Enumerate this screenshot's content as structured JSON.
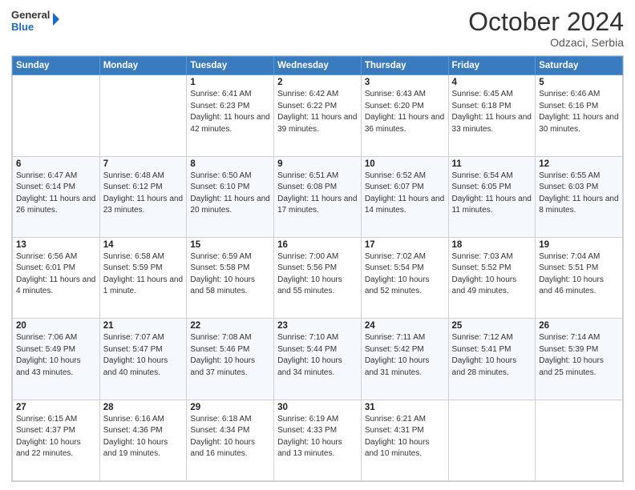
{
  "header": {
    "logo_general": "General",
    "logo_blue": "Blue",
    "month_title": "October 2024",
    "subtitle": "Odzaci, Serbia"
  },
  "weekdays": [
    "Sunday",
    "Monday",
    "Tuesday",
    "Wednesday",
    "Thursday",
    "Friday",
    "Saturday"
  ],
  "weeks": [
    [
      {
        "day": "",
        "info": ""
      },
      {
        "day": "",
        "info": ""
      },
      {
        "day": "1",
        "info": "Sunrise: 6:41 AM\nSunset: 6:23 PM\nDaylight: 11 hours and 42 minutes."
      },
      {
        "day": "2",
        "info": "Sunrise: 6:42 AM\nSunset: 6:22 PM\nDaylight: 11 hours and 39 minutes."
      },
      {
        "day": "3",
        "info": "Sunrise: 6:43 AM\nSunset: 6:20 PM\nDaylight: 11 hours and 36 minutes."
      },
      {
        "day": "4",
        "info": "Sunrise: 6:45 AM\nSunset: 6:18 PM\nDaylight: 11 hours and 33 minutes."
      },
      {
        "day": "5",
        "info": "Sunrise: 6:46 AM\nSunset: 6:16 PM\nDaylight: 11 hours and 30 minutes."
      }
    ],
    [
      {
        "day": "6",
        "info": "Sunrise: 6:47 AM\nSunset: 6:14 PM\nDaylight: 11 hours and 26 minutes."
      },
      {
        "day": "7",
        "info": "Sunrise: 6:48 AM\nSunset: 6:12 PM\nDaylight: 11 hours and 23 minutes."
      },
      {
        "day": "8",
        "info": "Sunrise: 6:50 AM\nSunset: 6:10 PM\nDaylight: 11 hours and 20 minutes."
      },
      {
        "day": "9",
        "info": "Sunrise: 6:51 AM\nSunset: 6:08 PM\nDaylight: 11 hours and 17 minutes."
      },
      {
        "day": "10",
        "info": "Sunrise: 6:52 AM\nSunset: 6:07 PM\nDaylight: 11 hours and 14 minutes."
      },
      {
        "day": "11",
        "info": "Sunrise: 6:54 AM\nSunset: 6:05 PM\nDaylight: 11 hours and 11 minutes."
      },
      {
        "day": "12",
        "info": "Sunrise: 6:55 AM\nSunset: 6:03 PM\nDaylight: 11 hours and 8 minutes."
      }
    ],
    [
      {
        "day": "13",
        "info": "Sunrise: 6:56 AM\nSunset: 6:01 PM\nDaylight: 11 hours and 4 minutes."
      },
      {
        "day": "14",
        "info": "Sunrise: 6:58 AM\nSunset: 5:59 PM\nDaylight: 11 hours and 1 minute."
      },
      {
        "day": "15",
        "info": "Sunrise: 6:59 AM\nSunset: 5:58 PM\nDaylight: 10 hours and 58 minutes."
      },
      {
        "day": "16",
        "info": "Sunrise: 7:00 AM\nSunset: 5:56 PM\nDaylight: 10 hours and 55 minutes."
      },
      {
        "day": "17",
        "info": "Sunrise: 7:02 AM\nSunset: 5:54 PM\nDaylight: 10 hours and 52 minutes."
      },
      {
        "day": "18",
        "info": "Sunrise: 7:03 AM\nSunset: 5:52 PM\nDaylight: 10 hours and 49 minutes."
      },
      {
        "day": "19",
        "info": "Sunrise: 7:04 AM\nSunset: 5:51 PM\nDaylight: 10 hours and 46 minutes."
      }
    ],
    [
      {
        "day": "20",
        "info": "Sunrise: 7:06 AM\nSunset: 5:49 PM\nDaylight: 10 hours and 43 minutes."
      },
      {
        "day": "21",
        "info": "Sunrise: 7:07 AM\nSunset: 5:47 PM\nDaylight: 10 hours and 40 minutes."
      },
      {
        "day": "22",
        "info": "Sunrise: 7:08 AM\nSunset: 5:46 PM\nDaylight: 10 hours and 37 minutes."
      },
      {
        "day": "23",
        "info": "Sunrise: 7:10 AM\nSunset: 5:44 PM\nDaylight: 10 hours and 34 minutes."
      },
      {
        "day": "24",
        "info": "Sunrise: 7:11 AM\nSunset: 5:42 PM\nDaylight: 10 hours and 31 minutes."
      },
      {
        "day": "25",
        "info": "Sunrise: 7:12 AM\nSunset: 5:41 PM\nDaylight: 10 hours and 28 minutes."
      },
      {
        "day": "26",
        "info": "Sunrise: 7:14 AM\nSunset: 5:39 PM\nDaylight: 10 hours and 25 minutes."
      }
    ],
    [
      {
        "day": "27",
        "info": "Sunrise: 6:15 AM\nSunset: 4:37 PM\nDaylight: 10 hours and 22 minutes."
      },
      {
        "day": "28",
        "info": "Sunrise: 6:16 AM\nSunset: 4:36 PM\nDaylight: 10 hours and 19 minutes."
      },
      {
        "day": "29",
        "info": "Sunrise: 6:18 AM\nSunset: 4:34 PM\nDaylight: 10 hours and 16 minutes."
      },
      {
        "day": "30",
        "info": "Sunrise: 6:19 AM\nSunset: 4:33 PM\nDaylight: 10 hours and 13 minutes."
      },
      {
        "day": "31",
        "info": "Sunrise: 6:21 AM\nSunset: 4:31 PM\nDaylight: 10 hours and 10 minutes."
      },
      {
        "day": "",
        "info": ""
      },
      {
        "day": "",
        "info": ""
      }
    ]
  ]
}
